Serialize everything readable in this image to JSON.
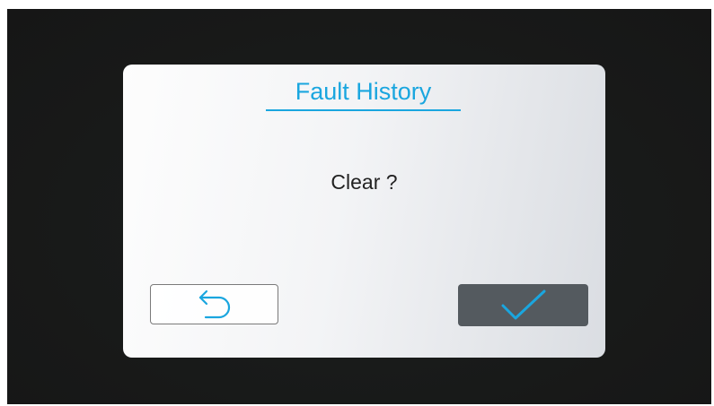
{
  "dialog": {
    "title": "Fault History",
    "message": "Clear ?"
  },
  "buttons": {
    "back_icon": "undo-arrow-icon",
    "confirm_icon": "checkmark-icon"
  },
  "colors": {
    "accent": "#1aa6df",
    "confirm_bg": "#545a5f",
    "screen_bg": "#171918"
  }
}
